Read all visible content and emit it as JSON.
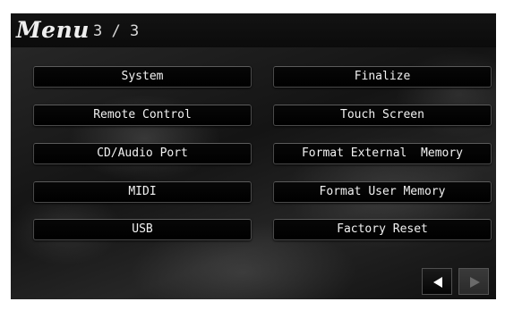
{
  "header": {
    "title": "Menu",
    "page_indicator": "3 / 3"
  },
  "menu": {
    "left": [
      {
        "label": "System"
      },
      {
        "label": "Remote Control"
      },
      {
        "label": "CD/Audio Port"
      },
      {
        "label": "MIDI"
      },
      {
        "label": "USB"
      }
    ],
    "right": [
      {
        "label": "Finalize"
      },
      {
        "label": "Touch Screen"
      },
      {
        "label": "Format External  Memory"
      },
      {
        "label": "Format User Memory"
      },
      {
        "label": "Factory Reset"
      }
    ]
  },
  "navigation": {
    "prev_icon": "triangle-left-icon",
    "next_icon": "triangle-right-icon",
    "prev_enabled": true,
    "next_enabled": false
  },
  "colors": {
    "button_text": "#f2f2f2",
    "next_arrow_disabled": "#6a6a6a"
  }
}
